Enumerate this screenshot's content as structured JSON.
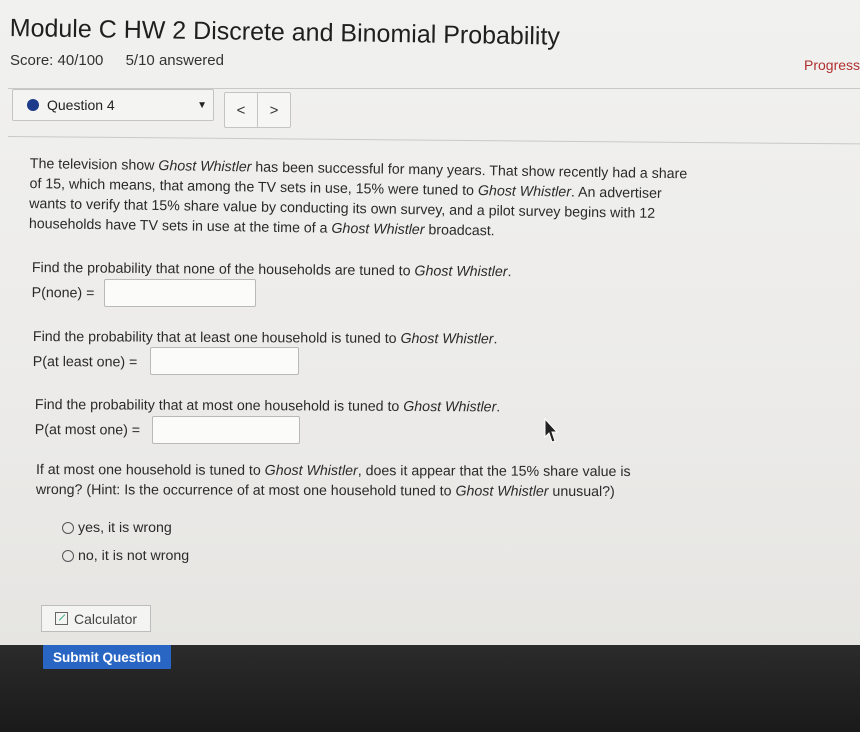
{
  "header": {
    "title": "Module C HW 2 Discrete and Binomial Probability",
    "score": "Score: 40/100",
    "answered": "5/10 answered",
    "progress_link": "Progress s"
  },
  "question_nav": {
    "selected_question": "Question 4",
    "prev_label": "<",
    "next_label": ">"
  },
  "problem": {
    "p1": "The television show ",
    "show": "Ghost Whistler",
    "p2": " has been successful for many years. That show recently had a share of 15, which means, that among the TV sets in use, 15% were tuned to ",
    "p3": ". An advertiser wants to verify that 15% share value by conducting its own survey, and a pilot survey begins with 12 households have TV sets in use at the time of a ",
    "p4": " broadcast."
  },
  "parts": [
    {
      "prompt": "Find the probability that none of the households are tuned to ",
      "label": "P(none) =",
      "value": ""
    },
    {
      "prompt": "Find the probability that at least one household is tuned to ",
      "label": "P(at least one) =",
      "value": ""
    },
    {
      "prompt": "Find the probability that at most one household is tuned to ",
      "label": "P(at most one) =",
      "value": ""
    }
  ],
  "final_question": {
    "q1": "If at most one household is tuned to ",
    "q2": ", does it appear that the 15% share value is wrong? (Hint: Is the occurrence of at most one household tuned to ",
    "q3": " unusual?)",
    "options": [
      "yes, it is wrong",
      "no, it is not wrong"
    ]
  },
  "buttons": {
    "calculator": "Calculator",
    "submit": "Submit Question"
  },
  "colors": {
    "accent_blue": "#2966c4",
    "question_dot": "#1e3a8a",
    "progress_link": "#b03030"
  }
}
